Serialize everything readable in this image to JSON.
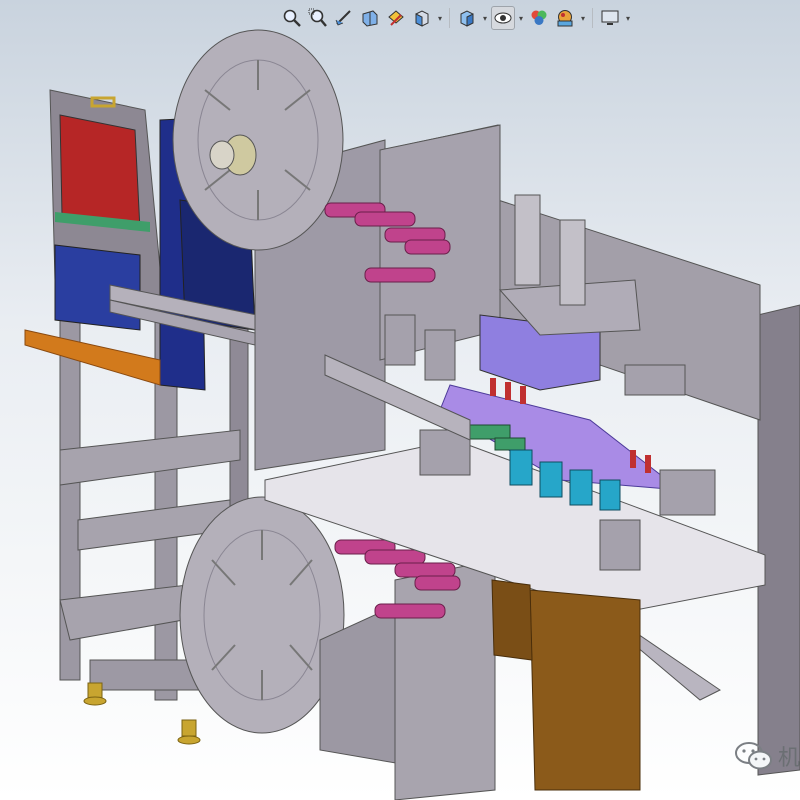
{
  "app": {
    "type": "3D CAD model viewport"
  },
  "toolbar": {
    "buttons": [
      {
        "icon": "zoom-to-fit-icon",
        "has_menu": false
      },
      {
        "icon": "zoom-to-area-icon",
        "has_menu": false
      },
      {
        "icon": "previous-view-icon",
        "has_menu": false
      },
      {
        "icon": "section-view-icon",
        "has_menu": false
      },
      {
        "icon": "dynamic-annotation-view-icon",
        "has_menu": false
      },
      {
        "icon": "view-orientation-icon",
        "has_menu": true
      },
      {
        "icon": "display-style-icon",
        "has_menu": true
      },
      {
        "icon": "hide-show-items-icon",
        "has_menu": true,
        "active": true
      },
      {
        "icon": "edit-appearance-icon",
        "has_menu": false
      },
      {
        "icon": "apply-scene-icon",
        "has_menu": true
      },
      {
        "icon": "view-settings-icon",
        "has_menu": true
      }
    ]
  },
  "watermark": {
    "text": "机",
    "icon": "wechat-icon"
  },
  "colors": {
    "sheet_metal": "#8f8a96",
    "red_panel": "#b62626",
    "blue_panel": "#1f2e8a",
    "pink_rollers": "#c0438c",
    "orange_handle": "#d27a1c",
    "brass_feet": "#c8a530",
    "purple_chute": "#a98be6",
    "green_parts": "#3f9e6a",
    "cyan_parts": "#26a6c9",
    "brown_panel": "#8b5a1a"
  }
}
